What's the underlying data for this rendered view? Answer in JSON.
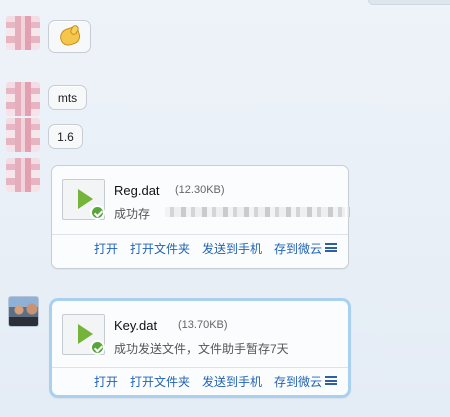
{
  "messages": {
    "mts": "mts",
    "version": "1.6"
  },
  "files": [
    {
      "name": "Reg.dat",
      "size": "(12.30KB)",
      "status": "成功存",
      "actions": [
        "打开",
        "打开文件夹",
        "发送到手机",
        "存到微云"
      ]
    },
    {
      "name": "Key.dat",
      "size": "(13.70KB)",
      "status": "成功发送文件，文件助手暂存7天",
      "actions": [
        "打开",
        "打开文件夹",
        "发送到手机",
        "存到微云"
      ]
    }
  ],
  "icons": {
    "emoji": "ok-hand-icon",
    "file": "video-file-icon",
    "status": "check-circle-icon",
    "menu": "menu-icon"
  },
  "colors": {
    "link": "#2063b8",
    "success": "#5aa53b",
    "selected_border": "#a9d1ef"
  }
}
